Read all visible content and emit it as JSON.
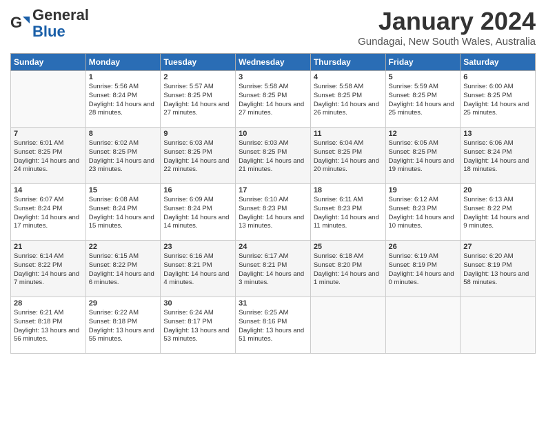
{
  "header": {
    "logo_general": "General",
    "logo_blue": "Blue",
    "month": "January 2024",
    "location": "Gundagai, New South Wales, Australia"
  },
  "weekdays": [
    "Sunday",
    "Monday",
    "Tuesday",
    "Wednesday",
    "Thursday",
    "Friday",
    "Saturday"
  ],
  "weeks": [
    [
      {
        "day": "",
        "sunrise": "",
        "sunset": "",
        "daylight": ""
      },
      {
        "day": "1",
        "sunrise": "Sunrise: 5:56 AM",
        "sunset": "Sunset: 8:24 PM",
        "daylight": "Daylight: 14 hours and 28 minutes."
      },
      {
        "day": "2",
        "sunrise": "Sunrise: 5:57 AM",
        "sunset": "Sunset: 8:25 PM",
        "daylight": "Daylight: 14 hours and 27 minutes."
      },
      {
        "day": "3",
        "sunrise": "Sunrise: 5:58 AM",
        "sunset": "Sunset: 8:25 PM",
        "daylight": "Daylight: 14 hours and 27 minutes."
      },
      {
        "day": "4",
        "sunrise": "Sunrise: 5:58 AM",
        "sunset": "Sunset: 8:25 PM",
        "daylight": "Daylight: 14 hours and 26 minutes."
      },
      {
        "day": "5",
        "sunrise": "Sunrise: 5:59 AM",
        "sunset": "Sunset: 8:25 PM",
        "daylight": "Daylight: 14 hours and 25 minutes."
      },
      {
        "day": "6",
        "sunrise": "Sunrise: 6:00 AM",
        "sunset": "Sunset: 8:25 PM",
        "daylight": "Daylight: 14 hours and 25 minutes."
      }
    ],
    [
      {
        "day": "7",
        "sunrise": "Sunrise: 6:01 AM",
        "sunset": "Sunset: 8:25 PM",
        "daylight": "Daylight: 14 hours and 24 minutes."
      },
      {
        "day": "8",
        "sunrise": "Sunrise: 6:02 AM",
        "sunset": "Sunset: 8:25 PM",
        "daylight": "Daylight: 14 hours and 23 minutes."
      },
      {
        "day": "9",
        "sunrise": "Sunrise: 6:03 AM",
        "sunset": "Sunset: 8:25 PM",
        "daylight": "Daylight: 14 hours and 22 minutes."
      },
      {
        "day": "10",
        "sunrise": "Sunrise: 6:03 AM",
        "sunset": "Sunset: 8:25 PM",
        "daylight": "Daylight: 14 hours and 21 minutes."
      },
      {
        "day": "11",
        "sunrise": "Sunrise: 6:04 AM",
        "sunset": "Sunset: 8:25 PM",
        "daylight": "Daylight: 14 hours and 20 minutes."
      },
      {
        "day": "12",
        "sunrise": "Sunrise: 6:05 AM",
        "sunset": "Sunset: 8:25 PM",
        "daylight": "Daylight: 14 hours and 19 minutes."
      },
      {
        "day": "13",
        "sunrise": "Sunrise: 6:06 AM",
        "sunset": "Sunset: 8:24 PM",
        "daylight": "Daylight: 14 hours and 18 minutes."
      }
    ],
    [
      {
        "day": "14",
        "sunrise": "Sunrise: 6:07 AM",
        "sunset": "Sunset: 8:24 PM",
        "daylight": "Daylight: 14 hours and 17 minutes."
      },
      {
        "day": "15",
        "sunrise": "Sunrise: 6:08 AM",
        "sunset": "Sunset: 8:24 PM",
        "daylight": "Daylight: 14 hours and 15 minutes."
      },
      {
        "day": "16",
        "sunrise": "Sunrise: 6:09 AM",
        "sunset": "Sunset: 8:24 PM",
        "daylight": "Daylight: 14 hours and 14 minutes."
      },
      {
        "day": "17",
        "sunrise": "Sunrise: 6:10 AM",
        "sunset": "Sunset: 8:23 PM",
        "daylight": "Daylight: 14 hours and 13 minutes."
      },
      {
        "day": "18",
        "sunrise": "Sunrise: 6:11 AM",
        "sunset": "Sunset: 8:23 PM",
        "daylight": "Daylight: 14 hours and 11 minutes."
      },
      {
        "day": "19",
        "sunrise": "Sunrise: 6:12 AM",
        "sunset": "Sunset: 8:23 PM",
        "daylight": "Daylight: 14 hours and 10 minutes."
      },
      {
        "day": "20",
        "sunrise": "Sunrise: 6:13 AM",
        "sunset": "Sunset: 8:22 PM",
        "daylight": "Daylight: 14 hours and 9 minutes."
      }
    ],
    [
      {
        "day": "21",
        "sunrise": "Sunrise: 6:14 AM",
        "sunset": "Sunset: 8:22 PM",
        "daylight": "Daylight: 14 hours and 7 minutes."
      },
      {
        "day": "22",
        "sunrise": "Sunrise: 6:15 AM",
        "sunset": "Sunset: 8:22 PM",
        "daylight": "Daylight: 14 hours and 6 minutes."
      },
      {
        "day": "23",
        "sunrise": "Sunrise: 6:16 AM",
        "sunset": "Sunset: 8:21 PM",
        "daylight": "Daylight: 14 hours and 4 minutes."
      },
      {
        "day": "24",
        "sunrise": "Sunrise: 6:17 AM",
        "sunset": "Sunset: 8:21 PM",
        "daylight": "Daylight: 14 hours and 3 minutes."
      },
      {
        "day": "25",
        "sunrise": "Sunrise: 6:18 AM",
        "sunset": "Sunset: 8:20 PM",
        "daylight": "Daylight: 14 hours and 1 minute."
      },
      {
        "day": "26",
        "sunrise": "Sunrise: 6:19 AM",
        "sunset": "Sunset: 8:19 PM",
        "daylight": "Daylight: 14 hours and 0 minutes."
      },
      {
        "day": "27",
        "sunrise": "Sunrise: 6:20 AM",
        "sunset": "Sunset: 8:19 PM",
        "daylight": "Daylight: 13 hours and 58 minutes."
      }
    ],
    [
      {
        "day": "28",
        "sunrise": "Sunrise: 6:21 AM",
        "sunset": "Sunset: 8:18 PM",
        "daylight": "Daylight: 13 hours and 56 minutes."
      },
      {
        "day": "29",
        "sunrise": "Sunrise: 6:22 AM",
        "sunset": "Sunset: 8:18 PM",
        "daylight": "Daylight: 13 hours and 55 minutes."
      },
      {
        "day": "30",
        "sunrise": "Sunrise: 6:24 AM",
        "sunset": "Sunset: 8:17 PM",
        "daylight": "Daylight: 13 hours and 53 minutes."
      },
      {
        "day": "31",
        "sunrise": "Sunrise: 6:25 AM",
        "sunset": "Sunset: 8:16 PM",
        "daylight": "Daylight: 13 hours and 51 minutes."
      },
      {
        "day": "",
        "sunrise": "",
        "sunset": "",
        "daylight": ""
      },
      {
        "day": "",
        "sunrise": "",
        "sunset": "",
        "daylight": ""
      },
      {
        "day": "",
        "sunrise": "",
        "sunset": "",
        "daylight": ""
      }
    ]
  ]
}
